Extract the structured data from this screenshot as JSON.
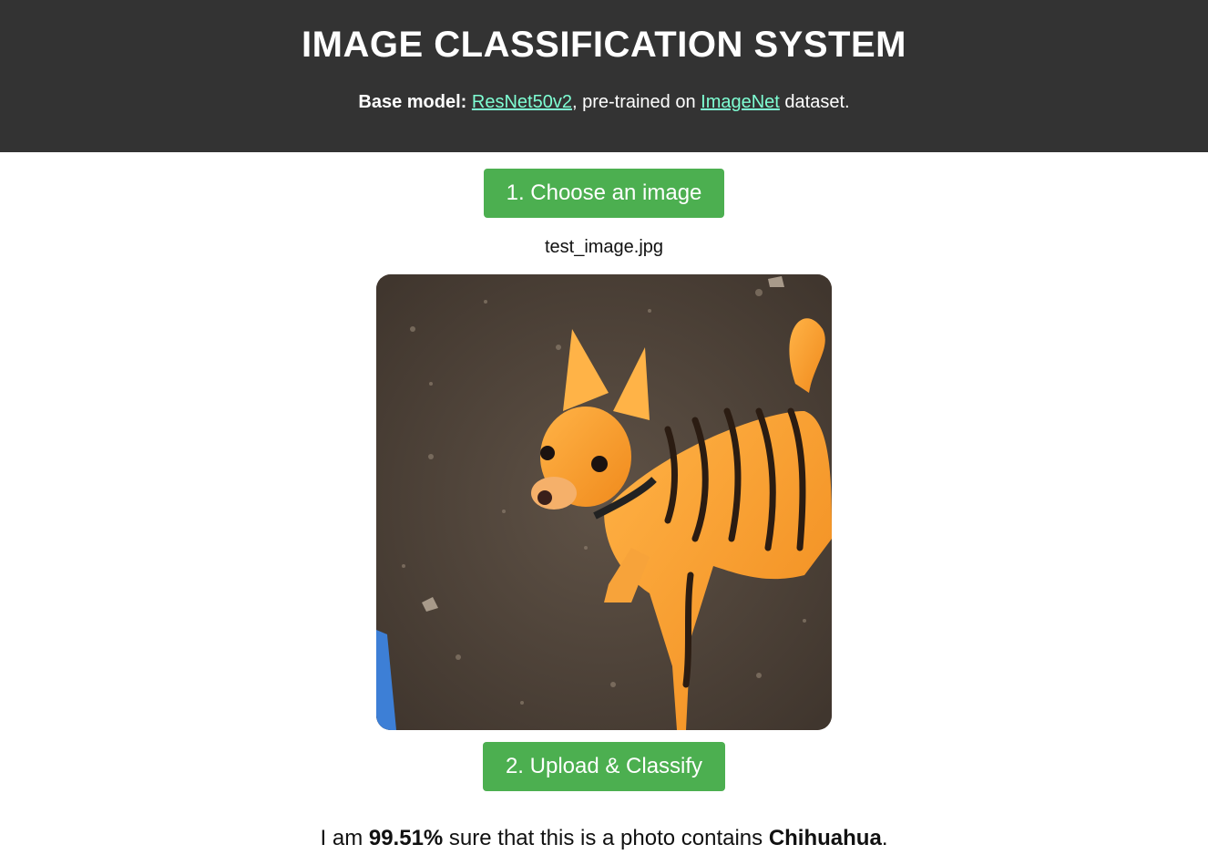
{
  "header": {
    "title": "IMAGE CLASSIFICATION SYSTEM",
    "base_label": "Base model:",
    "model_link": "ResNet50v2",
    "pretrained_text": ", pre-trained on ",
    "dataset_link": "ImageNet",
    "dataset_suffix": " dataset."
  },
  "controls": {
    "choose_label": "1. Choose an image",
    "file_name": "test_image.jpg",
    "upload_label": "2. Upload & Classify"
  },
  "image": {
    "description_icon": "dog-photo"
  },
  "result": {
    "prefix": "I am ",
    "confidence": "99.51%",
    "middle": " sure that this is a photo contains ",
    "label": "Chihuahua",
    "suffix": "."
  },
  "colors": {
    "header_bg": "#333333",
    "link": "#7fffd4",
    "button": "#4caf50"
  }
}
